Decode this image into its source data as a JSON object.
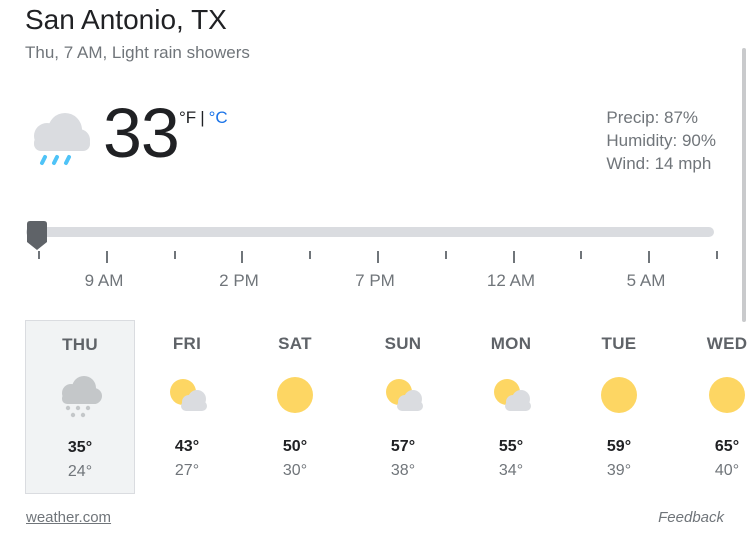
{
  "location": "San Antonio, TX",
  "subtitle": "Thu, 7 AM, Light rain showers",
  "current": {
    "temperature": "33",
    "unit_f": "°F",
    "unit_separator": "|",
    "unit_c": "°C",
    "condition_icon": "light-rain-showers-icon",
    "precip": "Precip: 87%",
    "humidity": "Humidity: 90%",
    "wind": "Wind: 14 mph"
  },
  "timeline": {
    "position": 0,
    "labels": [
      "9 AM",
      "2 PM",
      "7 PM",
      "12 AM",
      "5 AM"
    ]
  },
  "forecast": [
    {
      "day": "THU",
      "high": "35°",
      "low": "24°",
      "icon": "snow-showers-icon",
      "selected": true
    },
    {
      "day": "FRI",
      "high": "43°",
      "low": "27°",
      "icon": "partly-cloudy-icon",
      "selected": false
    },
    {
      "day": "SAT",
      "high": "50°",
      "low": "30°",
      "icon": "sunny-icon",
      "selected": false
    },
    {
      "day": "SUN",
      "high": "57°",
      "low": "38°",
      "icon": "partly-cloudy-icon",
      "selected": false
    },
    {
      "day": "MON",
      "high": "55°",
      "low": "34°",
      "icon": "partly-cloudy-icon",
      "selected": false
    },
    {
      "day": "TUE",
      "high": "59°",
      "low": "39°",
      "icon": "sunny-icon",
      "selected": false
    },
    {
      "day": "WED",
      "high": "65°",
      "low": "40°",
      "icon": "sunny-icon",
      "selected": false
    }
  ],
  "footer": {
    "source": "weather.com",
    "feedback": "Feedback"
  },
  "colors": {
    "accent": "#1a73e8",
    "sun": "#fdd663",
    "cloud": "#dadce0",
    "rain": "#4fc3f7",
    "track": "#dadce0",
    "handle": "#5f6368"
  }
}
